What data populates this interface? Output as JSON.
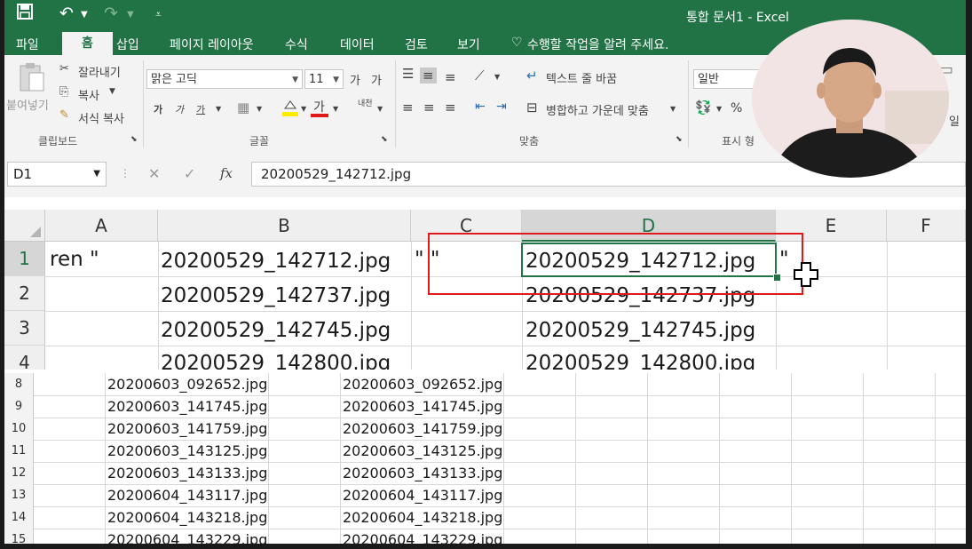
{
  "window": {
    "title": "통합 문서1  -  Excel"
  },
  "tabs": [
    "파일",
    "홈",
    "삽입",
    "페이지 레이아웃",
    "수식",
    "데이터",
    "검토",
    "보기"
  ],
  "tell_me": "수행할 작업을 알려 주세요.",
  "clipboard": {
    "paste": "붙여넣기",
    "cut": "잘라내기",
    "copy": "복사",
    "format_painter": "서식 복사",
    "group": "클립보드"
  },
  "font": {
    "name": "맑은 고딕",
    "size": "11",
    "group": "글꼴",
    "grow": "가",
    "shrink": "가",
    "bold": "가",
    "italic": "가",
    "underline": "가",
    "font_color_glyph": "가",
    "phonetic": "내천"
  },
  "alignment": {
    "wrap": "텍스트 줄 바꿈",
    "merge": "병합하고 가운데 맞춤",
    "group": "맞춤"
  },
  "number": {
    "format": "일반",
    "percent": "%",
    "group": "표시 형",
    "cut_label": "일"
  },
  "formula_bar": {
    "name_box": "D1",
    "fx": "fx",
    "value": "20200529_142712.jpg"
  },
  "zoom_grid": {
    "columns": [
      "A",
      "B",
      "C",
      "D",
      "E",
      "F"
    ],
    "rows": [
      "1",
      "2",
      "3",
      "4"
    ],
    "a1": "ren \"",
    "c1": "\" \"",
    "e1": "\"",
    "col_b": [
      "20200529_142712.jpg",
      "20200529_142737.jpg",
      "20200529_142745.jpg",
      "20200529_142800.jpg"
    ],
    "col_d": [
      "20200529_142712.jpg",
      "20200529_142737.jpg",
      "20200529_142745.jpg",
      "20200529_142800.jpg"
    ]
  },
  "lower_grid": {
    "rows": [
      "8",
      "9",
      "10",
      "11",
      "12",
      "13",
      "14",
      "15"
    ],
    "files": [
      "20200603_092652.jpg",
      "20200603_141745.jpg",
      "20200603_141759.jpg",
      "20200603_143125.jpg",
      "20200603_143133.jpg",
      "20200604_143117.jpg",
      "20200604_143218.jpg",
      "20200604_143229.jpg"
    ]
  },
  "colors": {
    "excel_green": "#217346",
    "highlight_red": "#e2191b"
  }
}
